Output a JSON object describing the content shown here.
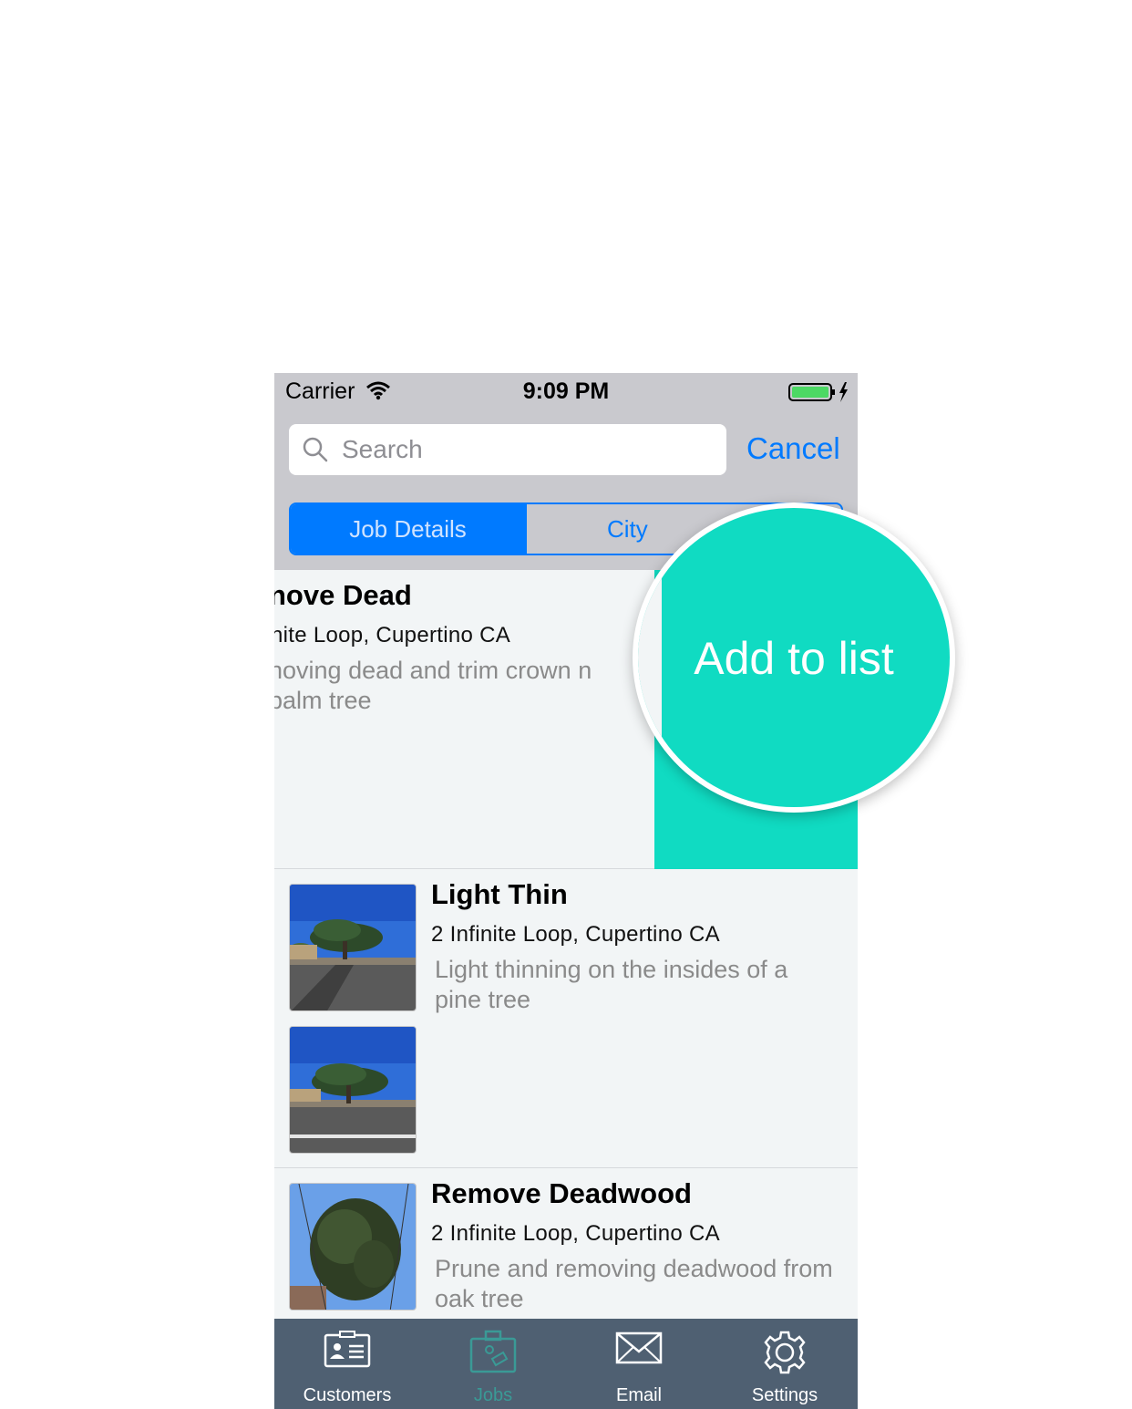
{
  "status_bar": {
    "carrier": "Carrier",
    "time": "9:09 PM"
  },
  "search": {
    "placeholder": "Search",
    "cancel_label": "Cancel"
  },
  "segments": [
    {
      "label": "Job Details",
      "selected": true
    },
    {
      "label": "City",
      "selected": false
    }
  ],
  "jobs": [
    {
      "title": "nove Dead",
      "address": "nite Loop, Cupertino CA",
      "description": "noving dead and trim crown n palm tree"
    },
    {
      "title": "Light Thin",
      "address": "2 Infinite Loop, Cupertino CA",
      "description": "Light thinning on the insides of a pine tree"
    },
    {
      "title": "Remove Deadwood",
      "address": "2 Infinite Loop, Cupertino CA",
      "description": "Prune and removing deadwood from oak tree"
    }
  ],
  "swipe_action": {
    "label": "Add to list",
    "color": "#10dbc2"
  },
  "tab_bar": {
    "tabs": [
      {
        "label": "Customers",
        "icon": "contact-card-icon",
        "active": false
      },
      {
        "label": "Jobs",
        "icon": "briefcase-icon",
        "active": true
      },
      {
        "label": "Email",
        "icon": "envelope-icon",
        "active": false
      },
      {
        "label": "Settings",
        "icon": "gear-icon",
        "active": false
      }
    ]
  },
  "colors": {
    "accent": "#007aff",
    "tab_bar": "#4f6072",
    "tab_active": "#3a9a96"
  }
}
